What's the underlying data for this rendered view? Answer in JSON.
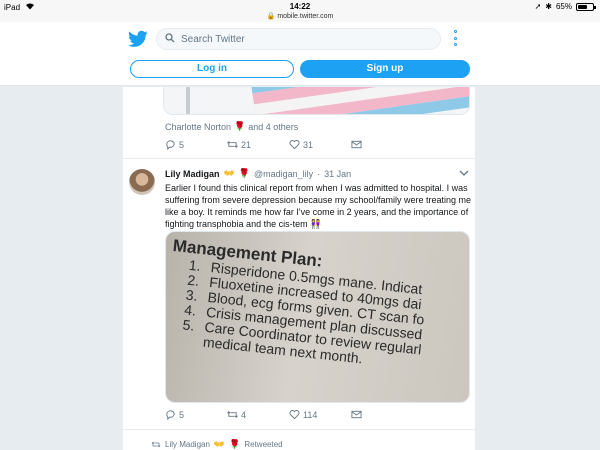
{
  "statusbar": {
    "device": "iPad",
    "time": "14:22",
    "url": "mobile.twitter.com",
    "battery": "65%",
    "battery_level": 0.65
  },
  "header": {
    "search_placeholder": "Search Twitter",
    "login_label": "Log in",
    "signup_label": "Sign up",
    "accent": "#1da1f2"
  },
  "tweet1": {
    "liked_by_name": "Charlotte Norton",
    "liked_by_rest": "and 4 others",
    "replies": "5",
    "retweets": "21",
    "likes": "31"
  },
  "tweet2": {
    "name": "Lily Madigan",
    "handle": "@madigan_lily",
    "date": "31 Jan",
    "text": "Earlier I found this clinical report from when I was admitted to hospital. I was suffering from severe depression because my school/family were treating me like a boy. It reminds me how far I've come in 2 years, and the importance of fighting transphobia and the cis-tem",
    "photo": {
      "title": "Management Plan:",
      "items": [
        {
          "n": "1.",
          "text": "Risperidone 0.5mgs mane. Indicat"
        },
        {
          "n": "2.",
          "text": "Fluoxetine increased to 40mgs dai"
        },
        {
          "n": "3.",
          "text": "Blood, ecg forms given. CT scan fo"
        },
        {
          "n": "4.",
          "text": "Crisis management plan discussed"
        },
        {
          "n": "5.",
          "text": "Care Coordinator to review regularl"
        }
      ],
      "continuation": "medical team next month."
    },
    "replies": "5",
    "retweets": "4",
    "likes": "114"
  },
  "tweet3": {
    "retweeted_by": "Lily Madigan",
    "retweeted_label": "Retweeted"
  }
}
